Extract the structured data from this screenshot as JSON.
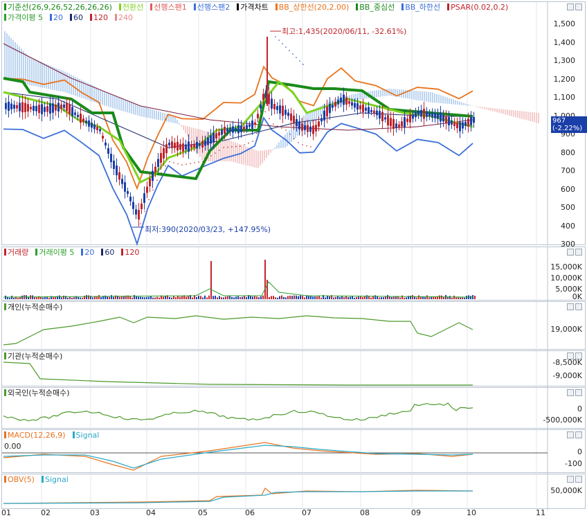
{
  "main_chart": {
    "legend": [
      {
        "label": "기준선(26,9,26,52,26,26,26)",
        "color": "#1a8a1a"
      },
      {
        "label": "전환선",
        "color": "#7ed321"
      },
      {
        "label": "선행스팬1",
        "color": "#e05a5a"
      },
      {
        "label": "선행스팬2",
        "color": "#3a6fd8"
      },
      {
        "label": "가격차트",
        "color": "#000000"
      },
      {
        "label": "BB_상한선(20,2.00)",
        "color": "#e8731e"
      },
      {
        "label": "BB_중심선",
        "color": "#1a8a1a"
      },
      {
        "label": "BB_하한선",
        "color": "#3a6fd8"
      },
      {
        "label": "PSAR(0.02,0.2)",
        "color": "#c0242a"
      }
    ],
    "legend2": [
      {
        "label": "가격이평 5",
        "color": "#2ea02e"
      },
      {
        "label": "20",
        "color": "#3a6fd8"
      },
      {
        "label": "60",
        "color": "#1a2a6a"
      },
      {
        "label": "120",
        "color": "#c0242a"
      },
      {
        "label": "240",
        "color": "#e58a8a"
      }
    ],
    "y_ticks": [
      "1,500",
      "1,400",
      "1,300",
      "1,200",
      "1,100",
      "1,000",
      "900",
      "800",
      "700",
      "600",
      "500",
      "400",
      "300"
    ],
    "current_price": "967",
    "current_change": "(-2.22%)",
    "high_annotation": "최고:1,435(2020/06/11, -32.61%)",
    "low_annotation": "최저:390(2020/03/23, +147.95%)"
  },
  "volume_pane": {
    "legend": [
      {
        "label": "거래량",
        "color": "#c0242a"
      },
      {
        "label": "거래이평 5",
        "color": "#2ea02e"
      },
      {
        "label": "20",
        "color": "#3a6fd8"
      },
      {
        "label": "60",
        "color": "#1a2a6a"
      },
      {
        "label": "120",
        "color": "#c0242a"
      }
    ],
    "y_ticks": [
      "15,000K",
      "10,000K",
      "5,000K",
      "0K"
    ]
  },
  "individual_pane": {
    "legend": "개인(누적순매수)",
    "color": "#4c9a2a",
    "y_ticks": [
      "19,000K"
    ]
  },
  "institution_pane": {
    "legend": "기관(누적순매수)",
    "color": "#4c9a2a",
    "y_ticks": [
      "-8,500K",
      "-9,000K"
    ]
  },
  "foreign_pane": {
    "legend": "외국인(누적순매수)",
    "color": "#4c9a2a",
    "y_ticks": [
      "0",
      "-500,000K"
    ]
  },
  "macd_pane": {
    "legend": [
      {
        "label": "MACD(12,26,9)",
        "color": "#e8731e"
      },
      {
        "label": "Signal",
        "color": "#2aa8c8"
      }
    ],
    "zero_label": "0.00",
    "y_ticks": [
      "0",
      "-100"
    ]
  },
  "obv_pane": {
    "legend": [
      {
        "label": "OBV(5)",
        "color": "#e8731e"
      },
      {
        "label": "Signal",
        "color": "#2aa8c8"
      }
    ],
    "y_ticks": [
      "50,000K"
    ]
  },
  "x_axis": {
    "labels": [
      "01",
      "02",
      "03",
      "04",
      "05",
      "06",
      "07",
      "08",
      "09",
      "10",
      "11"
    ]
  },
  "colors": {
    "up": "#c0242a",
    "down": "#1a3fa8",
    "grid": "#d9dee6",
    "cloud_up": "#e89a9a",
    "cloud_down": "#7aa8e0"
  }
}
